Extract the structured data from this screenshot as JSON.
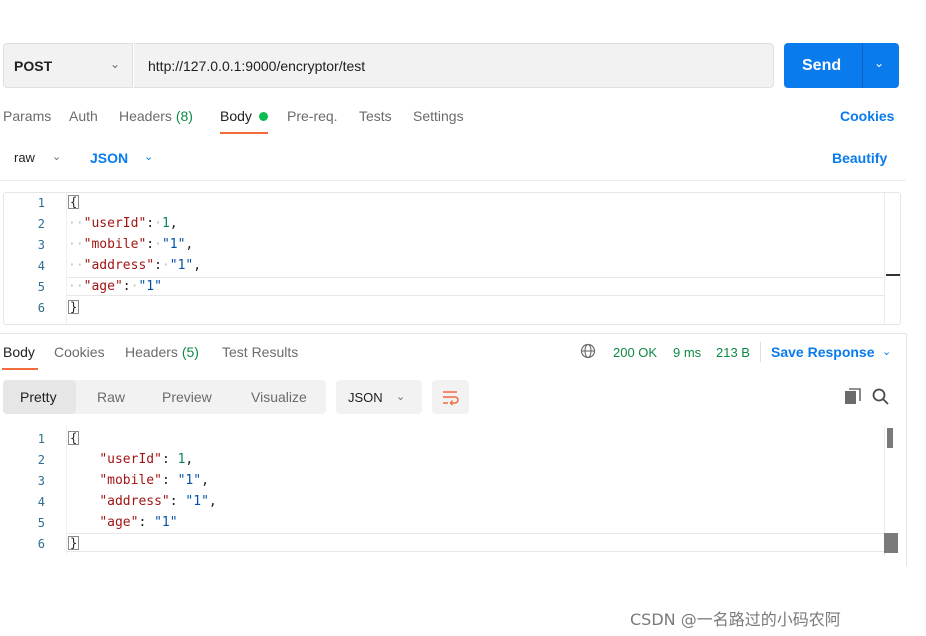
{
  "request": {
    "method": "POST",
    "url": "http://127.0.0.1:9000/encryptor/test",
    "send_label": "Send"
  },
  "request_tabs": {
    "params": "Params",
    "auth": "Auth",
    "headers": "Headers",
    "headers_count": "(8)",
    "body": "Body",
    "prereq": "Pre-req.",
    "tests": "Tests",
    "settings": "Settings",
    "cookies": "Cookies"
  },
  "body_type": {
    "mode": "raw",
    "language": "JSON",
    "beautify": "Beautify"
  },
  "request_body": {
    "line_numbers": [
      "1",
      "2",
      "3",
      "4",
      "5",
      "6"
    ],
    "open_brace": "{",
    "close_brace": "}",
    "fields": [
      {
        "key": "\"userId\"",
        "value": "1",
        "suffix": ","
      },
      {
        "key": "\"mobile\"",
        "value": "\"1\"",
        "suffix": ","
      },
      {
        "key": "\"address\"",
        "value": "\"1\"",
        "suffix": ","
      },
      {
        "key": "\"age\"",
        "value": "\"1\"",
        "suffix": ""
      }
    ]
  },
  "response_tabs": {
    "body": "Body",
    "cookies": "Cookies",
    "headers": "Headers",
    "headers_count": "(5)",
    "test_results": "Test Results"
  },
  "response_meta": {
    "status": "200 OK",
    "time": "9 ms",
    "size": "213 B",
    "save_response": "Save Response"
  },
  "response_view": {
    "pretty": "Pretty",
    "raw": "Raw",
    "preview": "Preview",
    "visualize": "Visualize",
    "format": "JSON"
  },
  "response_body": {
    "line_numbers": [
      "1",
      "2",
      "3",
      "4",
      "5",
      "6"
    ],
    "open_brace": "{",
    "close_brace": "}",
    "fields": [
      {
        "key": "\"userId\"",
        "value": "1",
        "suffix": ","
      },
      {
        "key": "\"mobile\"",
        "value": "\"1\"",
        "suffix": ","
      },
      {
        "key": "\"address\"",
        "value": "\"1\"",
        "suffix": ","
      },
      {
        "key": "\"age\"",
        "value": "\"1\"",
        "suffix": ""
      }
    ]
  },
  "watermark": "CSDN @一名路过的小码农阿",
  "colors": {
    "accent": "#097bed",
    "tab_underline": "#f26b3a",
    "status_ok": "#0e8a44",
    "json_key": "#a31515",
    "json_string": "#0451a5",
    "json_number": "#098658"
  }
}
